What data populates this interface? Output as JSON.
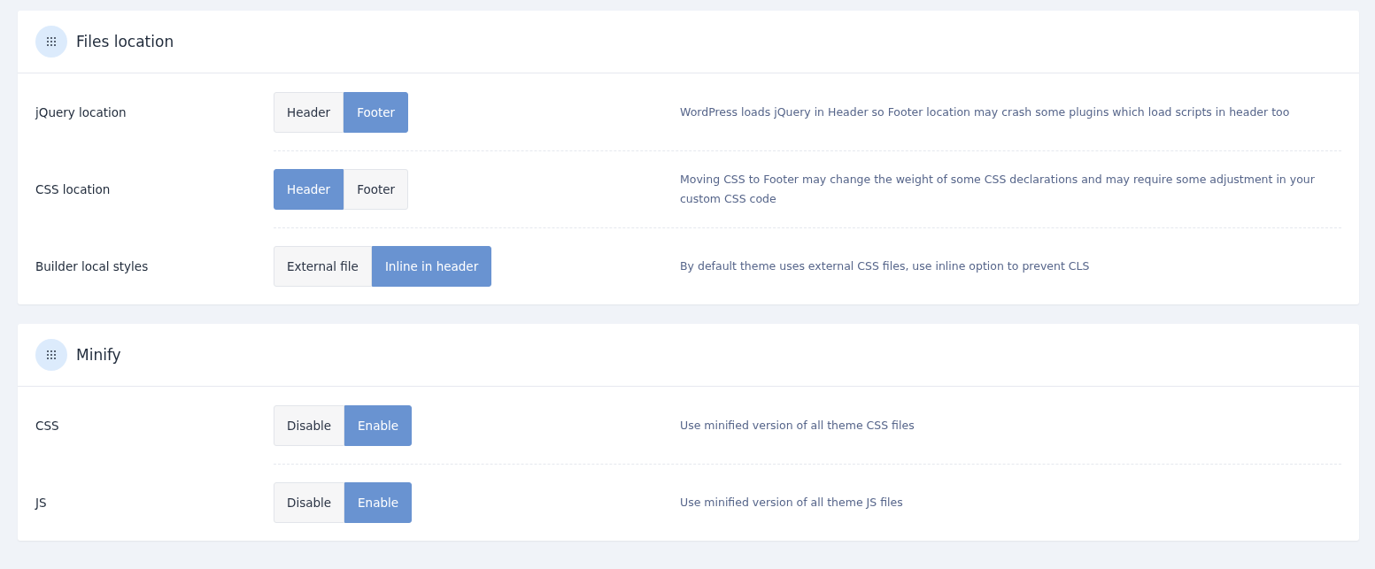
{
  "sections": [
    {
      "title": "Files location",
      "rows": [
        {
          "label": "jQuery location",
          "options": [
            {
              "label": "Header",
              "selected": false
            },
            {
              "label": "Footer",
              "selected": true
            }
          ],
          "description": "WordPress loads jQuery in Header so Footer location may crash some plugins which load scripts in header too"
        },
        {
          "label": "CSS location",
          "options": [
            {
              "label": "Header",
              "selected": true
            },
            {
              "label": "Footer",
              "selected": false
            }
          ],
          "description": "Moving CSS to Footer may change the weight of some CSS declarations and may require some adjustment in your custom CSS code"
        },
        {
          "label": "Builder local styles",
          "options": [
            {
              "label": "External file",
              "selected": false
            },
            {
              "label": "Inline in header",
              "selected": true
            }
          ],
          "description": "By default theme uses external CSS files, use inline option to prevent CLS"
        }
      ]
    },
    {
      "title": "Minify",
      "rows": [
        {
          "label": "CSS",
          "options": [
            {
              "label": "Disable",
              "selected": false
            },
            {
              "label": "Enable",
              "selected": true
            }
          ],
          "description": "Use minified version of all theme CSS files"
        },
        {
          "label": "JS",
          "options": [
            {
              "label": "Disable",
              "selected": false
            },
            {
              "label": "Enable",
              "selected": true
            }
          ],
          "description": "Use minified version of all theme JS files"
        }
      ]
    }
  ]
}
